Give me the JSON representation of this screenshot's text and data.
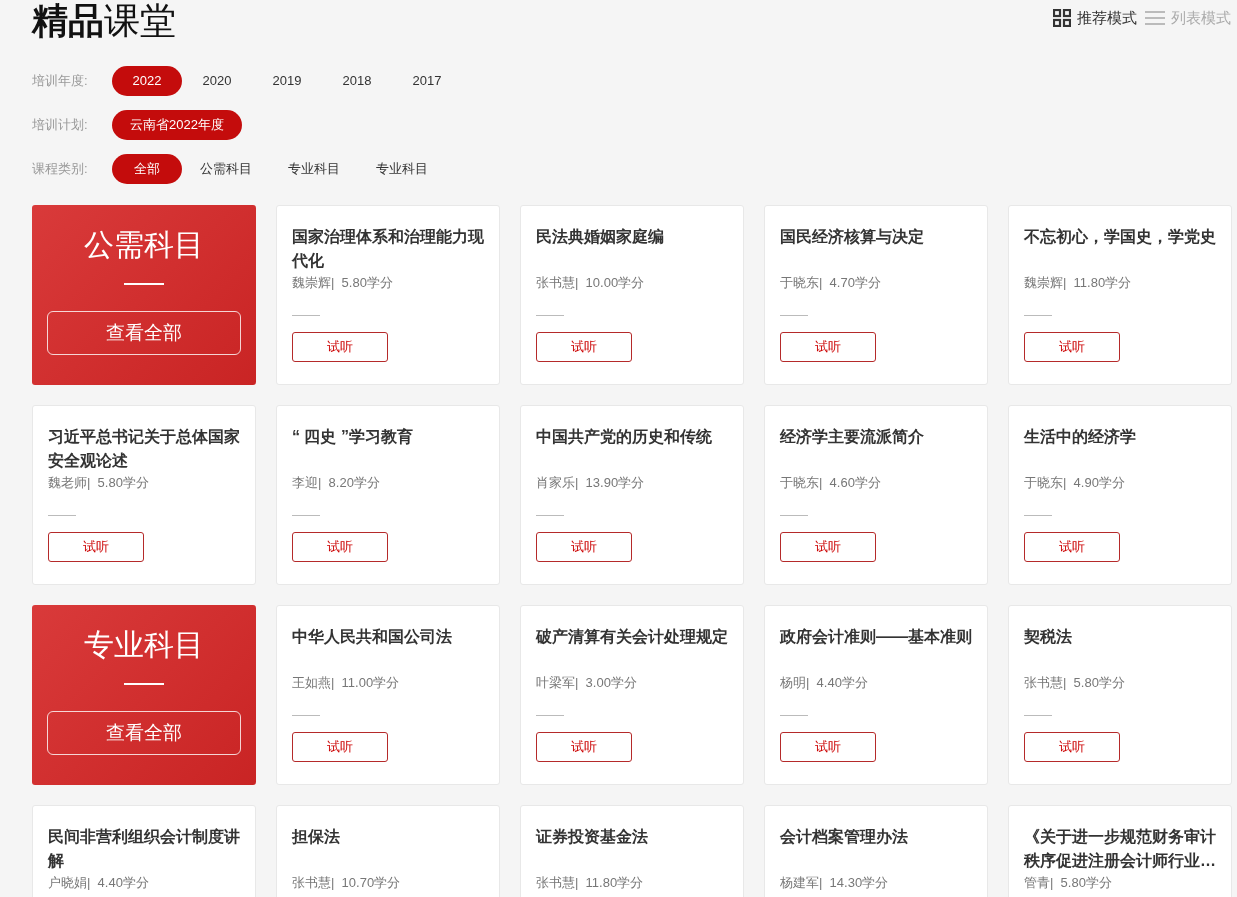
{
  "title": {
    "bold": "精品",
    "rest": "课堂"
  },
  "view_modes": [
    {
      "kind": "grid",
      "label": "推荐模式",
      "selected": true
    },
    {
      "kind": "list",
      "label": "列表模式",
      "selected": false
    }
  ],
  "filters": [
    {
      "label": "培训年度:",
      "options": [
        {
          "label": "2022",
          "selected": true
        },
        {
          "label": "2020",
          "selected": false
        },
        {
          "label": "2019",
          "selected": false
        },
        {
          "label": "2018",
          "selected": false
        },
        {
          "label": "2017",
          "selected": false
        }
      ]
    },
    {
      "label": "培训计划:",
      "options": [
        {
          "label": "云南省2022年度",
          "selected": true
        }
      ]
    },
    {
      "label": "课程类别:",
      "options": [
        {
          "label": "全部",
          "selected": true
        },
        {
          "label": "公需科目",
          "selected": false
        },
        {
          "label": "专业科目",
          "selected": false
        },
        {
          "label": "专业科目",
          "selected": false
        }
      ]
    }
  ],
  "sections": [
    {
      "category": {
        "title": "公需科目",
        "button": "查看全部"
      },
      "courses": [
        {
          "title": "国家治理体系和治理能力现代化",
          "meta": "魏崇辉|  5.80学分",
          "button": "试听"
        },
        {
          "title": "民法典婚姻家庭编",
          "meta": "张书慧|  10.00学分",
          "button": "试听"
        },
        {
          "title": "国民经济核算与决定",
          "meta": "于晓东|  4.70学分",
          "button": "试听"
        },
        {
          "title": "不忘初心，学国史，学党史",
          "meta": "魏崇辉|  11.80学分",
          "button": "试听"
        },
        {
          "title": "习近平总书记关于总体国家安全观论述",
          "meta": "魏老师|  5.80学分",
          "button": "试听"
        },
        {
          "title": "“ 四史 ”学习教育",
          "meta": "李迎|  8.20学分",
          "button": "试听"
        },
        {
          "title": "中国共产党的历史和传统",
          "meta": "肖家乐|  13.90学分",
          "button": "试听"
        },
        {
          "title": "经济学主要流派简介",
          "meta": "于晓东|  4.60学分",
          "button": "试听"
        },
        {
          "title": "生活中的经济学",
          "meta": "于晓东|  4.90学分",
          "button": "试听"
        }
      ]
    },
    {
      "category": {
        "title": "专业科目",
        "button": "查看全部"
      },
      "courses": [
        {
          "title": "中华人民共和国公司法",
          "meta": "王如燕|  11.00学分",
          "button": "试听"
        },
        {
          "title": "破产清算有关会计处理规定",
          "meta": "叶梁军|  3.00学分",
          "button": "试听"
        },
        {
          "title": "政府会计准则——基本准则",
          "meta": "杨明|  4.40学分",
          "button": "试听"
        },
        {
          "title": "契税法",
          "meta": "张书慧|  5.80学分",
          "button": "试听"
        },
        {
          "title": "民间非营利组织会计制度讲解",
          "meta": "户晓娟|  4.40学分"
        },
        {
          "title": "担保法",
          "meta": "张书慧|  10.70学分"
        },
        {
          "title": "证券投资基金法",
          "meta": "张书慧|  11.80学分"
        },
        {
          "title": "会计档案管理办法",
          "meta": "杨建军|  14.30学分"
        },
        {
          "title": "《关于进一步规范财务审计秩序促进注册会计师行业…",
          "meta": "管青|  5.80学分"
        }
      ]
    }
  ]
}
